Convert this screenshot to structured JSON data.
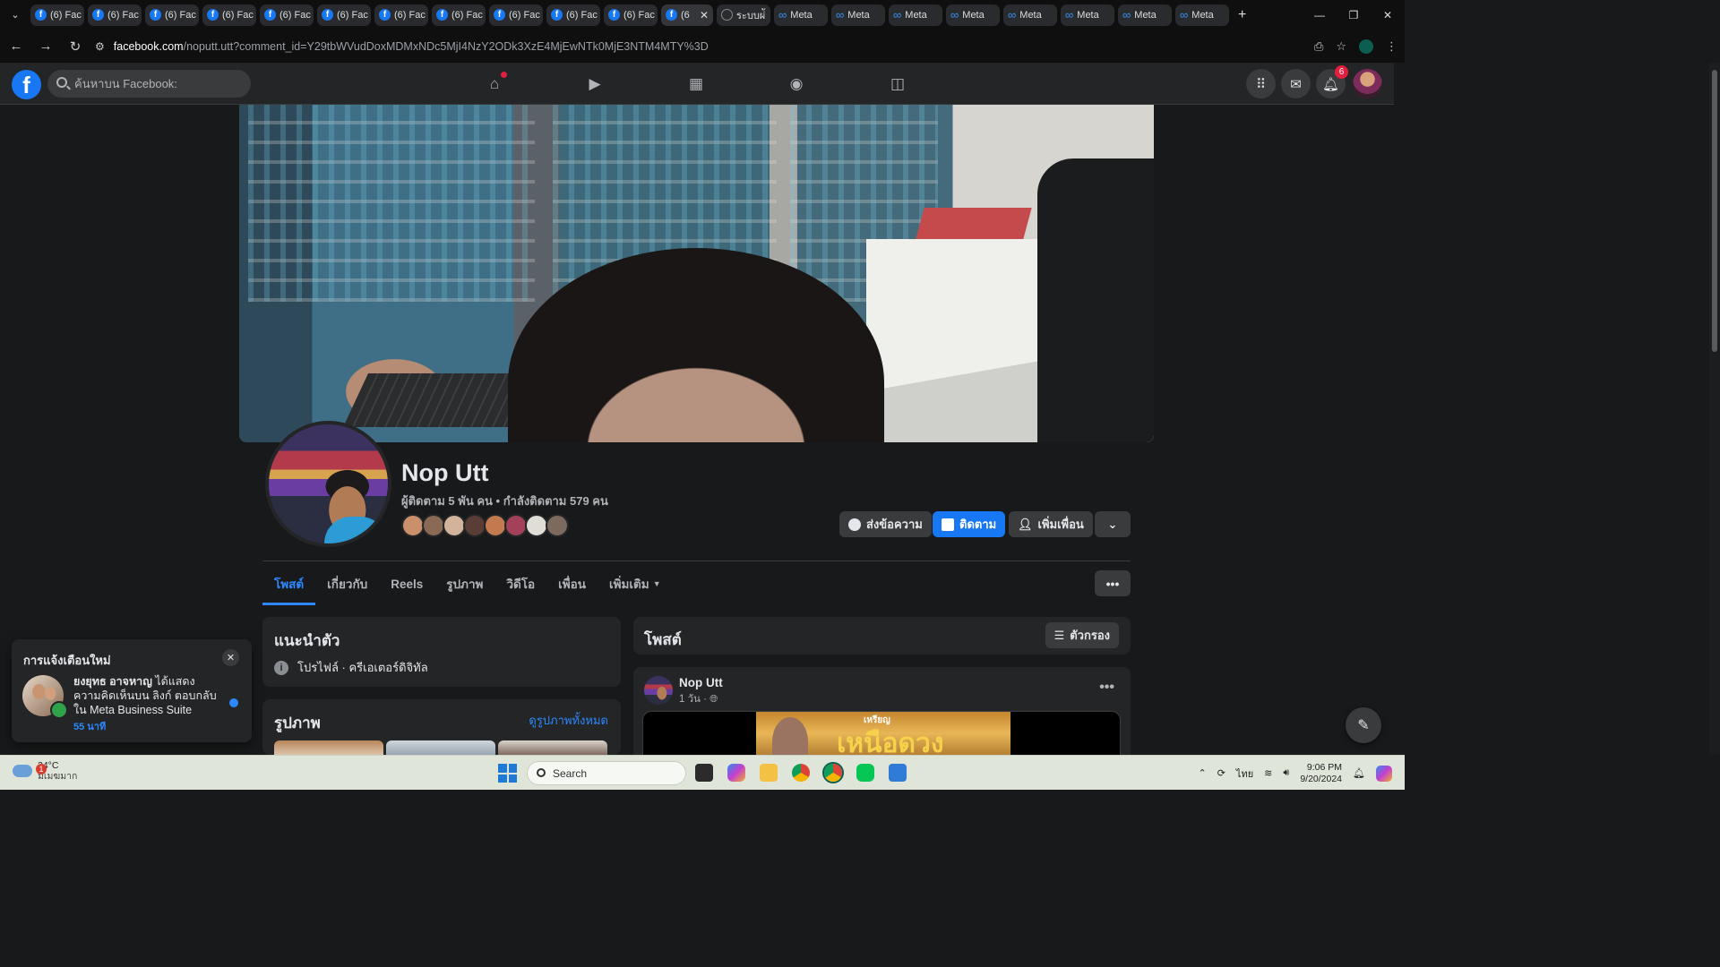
{
  "browser": {
    "tabs": [
      {
        "label": "(6) Fac",
        "icon": "facebook-icon"
      },
      {
        "label": "(6) Fac",
        "icon": "facebook-icon"
      },
      {
        "label": "(6) Fac",
        "icon": "facebook-icon"
      },
      {
        "label": "(6) Fac",
        "icon": "facebook-icon"
      },
      {
        "label": "(6) Fac",
        "icon": "facebook-icon"
      },
      {
        "label": "(6) Fac",
        "icon": "facebook-icon"
      },
      {
        "label": "(6) Fac",
        "icon": "facebook-icon"
      },
      {
        "label": "(6) Fac",
        "icon": "facebook-icon"
      },
      {
        "label": "(6) Fac",
        "icon": "facebook-icon"
      },
      {
        "label": "(6) Fac",
        "icon": "facebook-icon"
      },
      {
        "label": "(6) Fac",
        "icon": "facebook-icon"
      },
      {
        "label": "(6",
        "icon": "facebook-icon",
        "active": true
      },
      {
        "label": "ระบบผ่ั",
        "icon": "globe-icon"
      },
      {
        "label": "Meta",
        "icon": "meta-icon"
      },
      {
        "label": "Meta",
        "icon": "meta-icon"
      },
      {
        "label": "Meta",
        "icon": "meta-icon"
      },
      {
        "label": "Meta",
        "icon": "meta-icon"
      },
      {
        "label": "Meta",
        "icon": "meta-icon"
      },
      {
        "label": "Meta",
        "icon": "meta-icon"
      },
      {
        "label": "Meta",
        "icon": "meta-icon"
      },
      {
        "label": "Meta",
        "icon": "meta-icon"
      }
    ],
    "url_host": "facebook.com",
    "url_path": "/noputt.utt?comment_id=Y29tbWVudDoxMDMxNDc5MjI4NzY2ODk3XzE4MjEwNTk0MjE3NTM4MTY%3D"
  },
  "fb_nav": {
    "logo": "f",
    "search_placeholder": "ค้นหาบน Facebook:",
    "notifications_count": "6"
  },
  "profile": {
    "name": "Nop Utt",
    "stats": "ผู้ติดตาม 5 พัน คน • กำลังติดตาม 579 คน",
    "buttons": {
      "message": "ส่งข้อความ",
      "follow": "ติดตาม",
      "add_friend": "เพิ่มเพื่อน"
    },
    "tabs": [
      "โพสต์",
      "เกี่ยวกับ",
      "Reels",
      "รูปภาพ",
      "วิดีโอ",
      "เพื่อน",
      "เพิ่มเติม"
    ],
    "active_tab": "โพสต์"
  },
  "intro": {
    "title": "แนะนำตัว",
    "item": "โปรไฟล์ · ครีเอเตอร์ดิจิทัล"
  },
  "photos": {
    "title": "รูปภาพ",
    "see_all": "ดูรูปภาพทั้งหมด"
  },
  "posts": {
    "title": "โพสต์",
    "filter_label": "ตัวกรอง",
    "post": {
      "author": "Nop Utt",
      "meta": "1 วัน ·",
      "image_small_text": "เหรียญ",
      "image_big_text": "เหนือดวง"
    }
  },
  "notification": {
    "title": "การแจ้งเตือนใหม่",
    "actor": "ยงยุทธ อาจหาญ",
    "text": " ได้แสดงความคิดเห็นบน ลิงก์ ตอบกลับใน Meta Business Suite",
    "time": "55 นาที"
  },
  "taskbar": {
    "weather_badge": "1",
    "temperature": "24°C",
    "weather_desc": "มีเมฆมาก",
    "search_label": "Search",
    "language": "ไทย",
    "time": "9:06 PM",
    "date": "9/20/2024"
  },
  "colors": {
    "fb_blue": "#1877f2",
    "link_blue": "#2d88ff",
    "card_bg": "#242526",
    "page_bg": "#18191a"
  }
}
